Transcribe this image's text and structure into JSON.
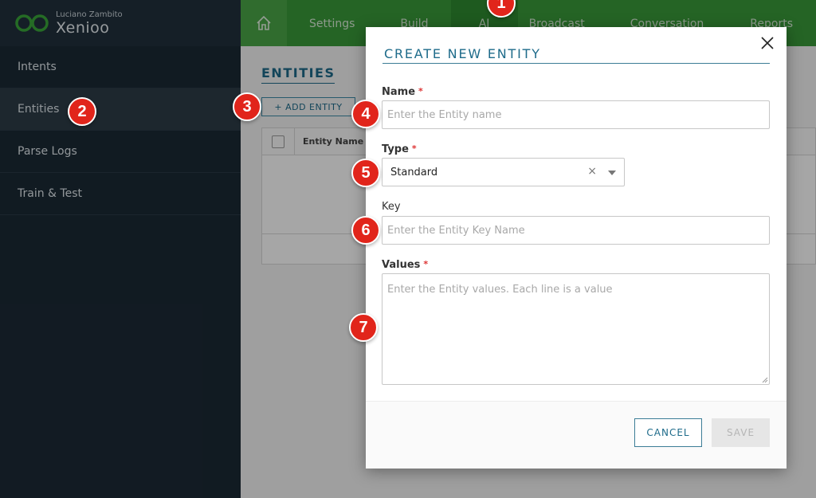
{
  "brand": {
    "user": "Luciano Zambito",
    "name": "Xenioo"
  },
  "sidebar": {
    "items": [
      {
        "label": "Intents"
      },
      {
        "label": "Entities"
      },
      {
        "label": "Parse Logs"
      },
      {
        "label": "Train & Test"
      }
    ]
  },
  "nav": {
    "tabs": [
      {
        "label": "Settings"
      },
      {
        "label": "Build"
      },
      {
        "label": "AI"
      },
      {
        "label": "Broadcast"
      },
      {
        "label": "Conversation"
      },
      {
        "label": "Reports"
      }
    ]
  },
  "main": {
    "title": "ENTITIES",
    "add_button": "+ ADD ENTITY",
    "table": {
      "column_entity_name": "Entity Name"
    }
  },
  "modal": {
    "title": "CREATE NEW ENTITY",
    "close_icon": "close-icon",
    "name": {
      "label": "Name",
      "required": "*",
      "placeholder": "Enter the Entity name"
    },
    "type": {
      "label": "Type",
      "required": "*",
      "value": "Standard",
      "clear": "×"
    },
    "key": {
      "label": "Key",
      "placeholder": "Enter the Entity Key Name"
    },
    "values": {
      "label": "Values",
      "required": "*",
      "placeholder": "Enter the Entity values. Each line is a value"
    },
    "cancel_label": "CANCEL",
    "save_label": "SAVE"
  },
  "badges": [
    "1",
    "2",
    "3",
    "4",
    "5",
    "6",
    "7"
  ],
  "colors": {
    "nav_green": "#3a9a3a",
    "accent_teal": "#1e6b8a",
    "sidebar_bg": "#1b2a35",
    "badge_red": "#e1251b"
  }
}
